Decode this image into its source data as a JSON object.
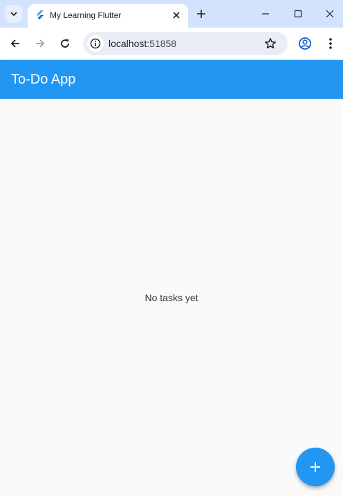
{
  "browser": {
    "tab_title": "My Learning Flutter",
    "url_host": "localhost",
    "url_port": ":51858"
  },
  "app": {
    "title": "To-Do App",
    "empty_message": "No tasks yet",
    "accent_color": "#2196f3"
  },
  "icons": {
    "tab_search": "chevron-down-icon",
    "favicon": "flutter-icon",
    "tab_close": "close-icon",
    "new_tab": "plus-icon",
    "minimize": "minimize-icon",
    "maximize": "maximize-icon",
    "close_window": "close-icon",
    "back": "arrow-left-icon",
    "forward": "arrow-right-icon",
    "reload": "reload-icon",
    "site_info": "info-icon",
    "bookmark": "star-icon",
    "profile": "profile-icon",
    "menu": "more-vert-icon",
    "fab": "plus-icon"
  }
}
